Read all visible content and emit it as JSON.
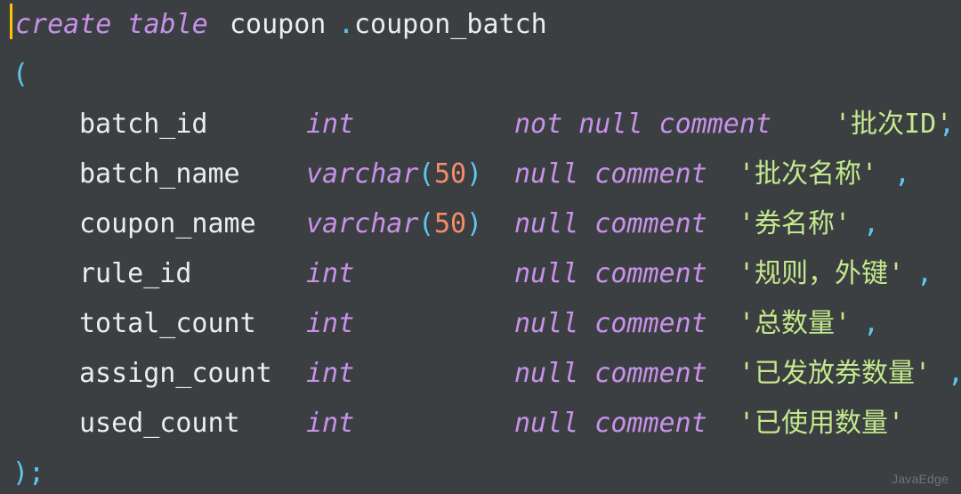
{
  "editor": {
    "background_color": "#3c3f41",
    "caret_color": "#ffc300",
    "font_size_px": 30,
    "line_height_px": 56
  },
  "colors": {
    "keyword": "#c792ea",
    "type": "#c792ea",
    "identifier": "#e9eef2",
    "punctuation": "#5bc8f5",
    "number": "#f78c6c",
    "string": "#c3e88d",
    "watermark": "#6f7377"
  },
  "watermark": {
    "text": "JavaEdge"
  },
  "code": {
    "language": "sql",
    "statement_header": {
      "keyword": "create table",
      "schema": "coupon",
      "dot": ".",
      "table": "coupon_batch"
    },
    "open_paren": "(",
    "close_statement": ");",
    "columns": [
      {
        "name": "batch_id",
        "type": "int",
        "type_paren_open": "",
        "type_length": "",
        "type_paren_close": "",
        "nullability": "not null comment",
        "comment": "'批次ID'",
        "trailing": ","
      },
      {
        "name": "batch_name",
        "type": "varchar",
        "type_paren_open": "(",
        "type_length": "50",
        "type_paren_close": ")",
        "nullability": "null comment",
        "comment": "'批次名称'",
        "trailing": ","
      },
      {
        "name": "coupon_name",
        "type": "varchar",
        "type_paren_open": "(",
        "type_length": "50",
        "type_paren_close": ")",
        "nullability": "null comment",
        "comment": "'券名称'",
        "trailing": ","
      },
      {
        "name": "rule_id",
        "type": "int",
        "type_paren_open": "",
        "type_length": "",
        "type_paren_close": "",
        "nullability": "null comment",
        "comment": "'规则，外键'",
        "trailing": ","
      },
      {
        "name": "total_count",
        "type": "int",
        "type_paren_open": "",
        "type_length": "",
        "type_paren_close": "",
        "nullability": "null comment",
        "comment": "'总数量'",
        "trailing": ","
      },
      {
        "name": "assign_count",
        "type": "int",
        "type_paren_open": "",
        "type_length": "",
        "type_paren_close": "",
        "nullability": "null comment",
        "comment": "'已发放券数量'",
        "trailing": ","
      },
      {
        "name": "used_count",
        "type": "int",
        "type_paren_open": "",
        "type_length": "",
        "type_paren_close": "",
        "nullability": "null comment",
        "comment": "'已使用数量'",
        "trailing": ""
      }
    ]
  }
}
